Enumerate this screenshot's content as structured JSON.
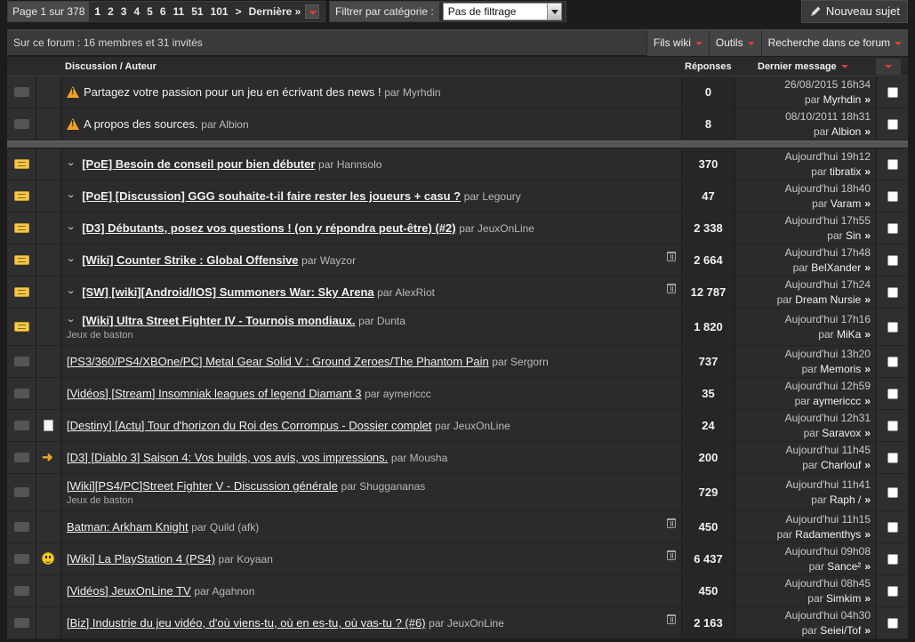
{
  "pager": {
    "label": "Page 1 sur 378",
    "current": "1",
    "pages": [
      "2",
      "3",
      "4",
      "5",
      "6",
      "11",
      "51",
      "101"
    ],
    "next": ">",
    "last": "Dernière »"
  },
  "filter": {
    "label": "Filtrer par catégorie :",
    "value": "Pas de filtrage"
  },
  "new_topic": "Nouveau sujet",
  "forum_info": "Sur ce forum : 16 membres et 31 invités",
  "menu": [
    "Fils wiki",
    "Outils",
    "Recherche dans ce forum"
  ],
  "columns": {
    "discussion": "Discussion / Auteur",
    "replies": "Réponses",
    "last": "Dernier message"
  },
  "sticky_rows": [
    {
      "title": "Partagez votre passion pour un jeu en écrivant des news !",
      "author": "par Myrhdin",
      "replies": "0",
      "date": "26/08/2015 16h34",
      "by": "par",
      "user": "Myrhdin"
    },
    {
      "title": "A propos des sources.",
      "author": "par Albion",
      "replies": "8",
      "date": "08/10/2011 18h31",
      "by": "par",
      "user": "Albion"
    }
  ],
  "rows": [
    {
      "status": "new",
      "title": "[PoE] Besoin de conseil pour bien débuter",
      "author": "par Hannsolo",
      "replies": "370",
      "date": "Aujourd'hui 19h12",
      "user": "tibratix",
      "expand": true,
      "bold": true
    },
    {
      "status": "new",
      "title": "[PoE] [Discussion] GGG souhaite-t-il faire rester les joueurs + casu ?",
      "author": "par Legoury",
      "replies": "47",
      "date": "Aujourd'hui 18h40",
      "user": "Varam",
      "expand": true,
      "bold": true
    },
    {
      "status": "new",
      "title": "[D3] Débutants, posez vos questions ! (on y répondra peut-être) (#2)",
      "author": "par JeuxOnLine",
      "replies": "2 338",
      "date": "Aujourd'hui 17h55",
      "user": "Sin",
      "expand": true,
      "bold": true
    },
    {
      "status": "new",
      "title": "[Wiki] Counter Strike : Global Offensive",
      "author": "par Wayzor",
      "replies": "2 664",
      "date": "Aujourd'hui 17h48",
      "user": "BelXander",
      "expand": true,
      "bold": true,
      "trash": true
    },
    {
      "status": "new",
      "title": "[SW] [wiki][Android/IOS] Summoners War: Sky Arena",
      "author": "par AlexRiot",
      "replies": "12 787",
      "date": "Aujourd'hui 17h24",
      "user": "Dream Nursie",
      "expand": true,
      "bold": true,
      "trash": true
    },
    {
      "status": "new",
      "title": "[Wiki] Ultra Street Fighter IV - Tournois mondiaux.",
      "author": "par Dunta",
      "sub": "Jeux de baston",
      "replies": "1 820",
      "date": "Aujourd'hui 17h16",
      "user": "MiKa",
      "expand": true,
      "bold": true
    },
    {
      "status": "read",
      "title": "[PS3/360/PS4/XBOne/PC] Metal Gear Solid V : Ground Zeroes/The Phantom Pain",
      "author": "par Sergorn",
      "replies": "737",
      "date": "Aujourd'hui 13h20",
      "user": "Memoris"
    },
    {
      "status": "read",
      "title": "[Vidéos] [Stream] Insomniak leagues of legend Diamant 3",
      "author": "par aymericcc",
      "replies": "35",
      "date": "Aujourd'hui 12h59",
      "user": "aymericcc"
    },
    {
      "status": "read",
      "icon": "document-icon",
      "title": "[Destiny] [Actu] Tour d'horizon du Roi des Corrompus - Dossier complet",
      "author": "par JeuxOnLine",
      "replies": "24",
      "date": "Aujourd'hui 12h31",
      "user": "Saravox"
    },
    {
      "status": "read",
      "icon": "arrow-icon",
      "title": "[D3] [Diablo 3] Saison 4: Vos builds, vos avis, vos impressions.",
      "author": "par Mousha",
      "replies": "200",
      "date": "Aujourd'hui 11h45",
      "user": "Charlouf"
    },
    {
      "status": "read",
      "title": "[Wiki][PS4/PC]Street Fighter V - Discussion générale",
      "author": "par Shuggananas",
      "sub": "Jeux de baston",
      "replies": "729",
      "date": "Aujourd'hui 11h41",
      "user": "Raph /"
    },
    {
      "status": "read",
      "title": "Batman: Arkham Knight",
      "author": "par Quild (afk)",
      "replies": "450",
      "date": "Aujourd'hui 11h15",
      "user": "Radamenthys",
      "trash": true
    },
    {
      "status": "read",
      "icon": "smiley-icon",
      "title": "[Wiki] La PlayStation 4 (PS4)",
      "author": "par Koyaan",
      "replies": "6 437",
      "date": "Aujourd'hui 09h08",
      "user": "Sance²",
      "trash": true
    },
    {
      "status": "read",
      "title": "[Vidéos] JeuxOnLine TV",
      "author": "par Agahnon",
      "replies": "450",
      "date": "Aujourd'hui 08h45",
      "user": "Simkim"
    },
    {
      "status": "read",
      "title": "[Biz] Industrie du jeu vidéo, d'où viens-tu, où en es-tu, où vas-tu ? (#6)",
      "author": "par JeuxOnLine",
      "replies": "2 163",
      "date": "Aujourd'hui 04h30",
      "user": "Seiei/Tof",
      "trash": true
    }
  ],
  "by_label": "par",
  "go_arrow": "»"
}
